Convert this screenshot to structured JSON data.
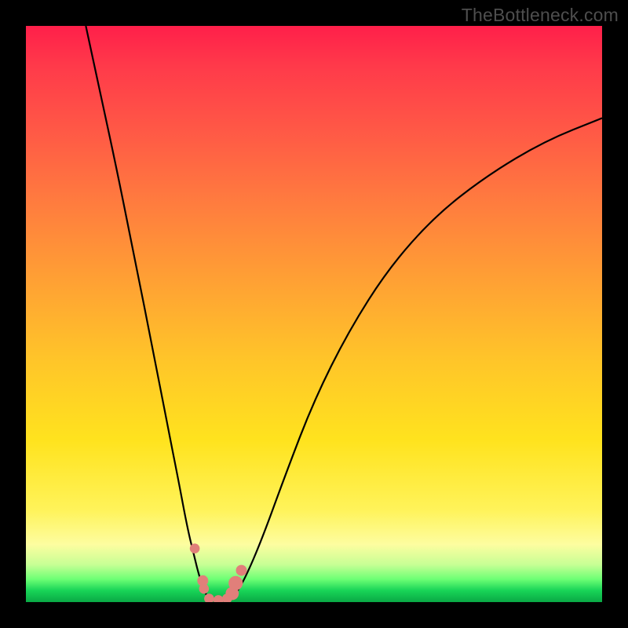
{
  "watermark": "TheBottleneck.com",
  "chart_data": {
    "type": "line",
    "title": "",
    "xlabel": "",
    "ylabel": "",
    "xlim": [
      0,
      100
    ],
    "ylim": [
      0,
      100
    ],
    "series": [
      {
        "name": "left-branch",
        "x": [
          10.4,
          13.0,
          16.0,
          19.0,
          22.0,
          24.5,
          26.5,
          28.0,
          29.2,
          30.2,
          31.5
        ],
        "y": [
          100,
          88,
          74,
          59,
          44,
          31,
          21,
          13,
          8,
          4,
          0.8
        ]
      },
      {
        "name": "valley",
        "x": [
          31.5,
          32.5,
          33.5,
          34.5,
          36.0
        ],
        "y": [
          0.8,
          0.4,
          0.3,
          0.4,
          0.8
        ]
      },
      {
        "name": "right-branch",
        "x": [
          36.0,
          38.0,
          41.0,
          45.0,
          50.0,
          56.0,
          63.0,
          71.0,
          80.0,
          90.0,
          100.0
        ],
        "y": [
          0.8,
          4,
          11,
          22,
          35,
          47,
          58,
          67,
          74,
          80,
          84
        ]
      }
    ],
    "points": [
      {
        "name": "p1",
        "x": 29.3,
        "y": 9.3,
        "r": 0.9
      },
      {
        "name": "p2",
        "x": 30.7,
        "y": 3.7,
        "r": 1.0
      },
      {
        "name": "p3",
        "x": 30.9,
        "y": 2.3,
        "r": 0.9
      },
      {
        "name": "p4",
        "x": 31.8,
        "y": 0.6,
        "r": 0.9
      },
      {
        "name": "p5",
        "x": 33.4,
        "y": 0.35,
        "r": 0.9
      },
      {
        "name": "p6",
        "x": 34.9,
        "y": 0.6,
        "r": 0.9
      },
      {
        "name": "p7",
        "x": 35.8,
        "y": 1.5,
        "r": 1.2
      },
      {
        "name": "p8",
        "x": 36.4,
        "y": 3.3,
        "r": 1.3
      },
      {
        "name": "p9",
        "x": 37.4,
        "y": 5.5,
        "r": 1.0
      }
    ],
    "gradient_stops": [
      {
        "pos": 0.0,
        "color": "#ff1f4a"
      },
      {
        "pos": 0.3,
        "color": "#ff7a3f"
      },
      {
        "pos": 0.58,
        "color": "#ffc529"
      },
      {
        "pos": 0.84,
        "color": "#fff35a"
      },
      {
        "pos": 0.94,
        "color": "#c7ff95"
      },
      {
        "pos": 1.0,
        "color": "#0aa845"
      }
    ]
  }
}
